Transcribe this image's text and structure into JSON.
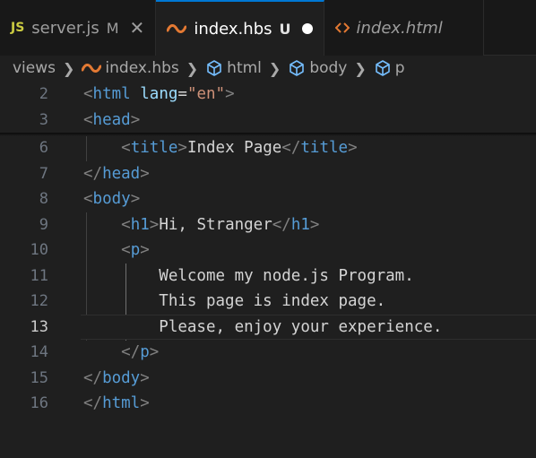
{
  "tabs": [
    {
      "icon": "js-file-icon",
      "icon_text": "JS",
      "label": "server.js",
      "status": "M",
      "active": false
    },
    {
      "icon": "handlebars-file-icon",
      "label": "index.hbs",
      "status": "U",
      "active": true
    },
    {
      "icon": "html-file-icon",
      "label": "index.html",
      "active": false
    }
  ],
  "breadcrumb": {
    "items": [
      "views",
      "index.hbs",
      "html",
      "body",
      "p"
    ]
  },
  "editor": {
    "current_line": "13",
    "lines": [
      {
        "num": "2",
        "tokens": [
          [
            "punc",
            "<"
          ],
          [
            "tag",
            "html"
          ],
          [
            "txt",
            " "
          ],
          [
            "attr",
            "lang"
          ],
          [
            "txt",
            "="
          ],
          [
            "str",
            "\"en\""
          ],
          [
            "punc",
            ">"
          ]
        ]
      },
      {
        "num": "3",
        "tokens": [
          [
            "punc",
            "<"
          ],
          [
            "tag",
            "head"
          ],
          [
            "punc",
            ">"
          ]
        ]
      },
      {
        "num": "6",
        "tokens": [
          [
            "txt",
            "    "
          ],
          [
            "punc",
            "<"
          ],
          [
            "tag",
            "title"
          ],
          [
            "punc",
            ">"
          ],
          [
            "txt",
            "Index Page"
          ],
          [
            "punc",
            "</"
          ],
          [
            "tag",
            "title"
          ],
          [
            "punc",
            ">"
          ]
        ]
      },
      {
        "num": "7",
        "tokens": [
          [
            "punc",
            "</"
          ],
          [
            "tag",
            "head"
          ],
          [
            "punc",
            ">"
          ]
        ]
      },
      {
        "num": "8",
        "tokens": [
          [
            "punc",
            "<"
          ],
          [
            "tag",
            "body"
          ],
          [
            "punc",
            ">"
          ]
        ]
      },
      {
        "num": "9",
        "tokens": [
          [
            "txt",
            "    "
          ],
          [
            "punc",
            "<"
          ],
          [
            "tag",
            "h1"
          ],
          [
            "punc",
            ">"
          ],
          [
            "txt",
            "Hi, Stranger"
          ],
          [
            "punc",
            "</"
          ],
          [
            "tag",
            "h1"
          ],
          [
            "punc",
            ">"
          ]
        ]
      },
      {
        "num": "10",
        "tokens": [
          [
            "txt",
            "    "
          ],
          [
            "punc",
            "<"
          ],
          [
            "tag",
            "p"
          ],
          [
            "punc",
            ">"
          ]
        ]
      },
      {
        "num": "11",
        "tokens": [
          [
            "txt",
            "        Welcome my node.js Program."
          ]
        ]
      },
      {
        "num": "12",
        "tokens": [
          [
            "txt",
            "        This page is index page."
          ]
        ]
      },
      {
        "num": "13",
        "tokens": [
          [
            "txt",
            "        Please, enjoy your experience."
          ]
        ]
      },
      {
        "num": "14",
        "tokens": [
          [
            "txt",
            "    "
          ],
          [
            "punc",
            "</"
          ],
          [
            "tag",
            "p"
          ],
          [
            "punc",
            ">"
          ]
        ]
      },
      {
        "num": "15",
        "tokens": [
          [
            "punc",
            "</"
          ],
          [
            "tag",
            "body"
          ],
          [
            "punc",
            ">"
          ]
        ]
      },
      {
        "num": "16",
        "tokens": [
          [
            "punc",
            "</"
          ],
          [
            "tag",
            "html"
          ],
          [
            "punc",
            ">"
          ]
        ]
      }
    ]
  },
  "colors": {
    "background": "#1f1f1f",
    "tag": "#569cd6",
    "attribute": "#9cdcfe",
    "string": "#ce9178",
    "punctuation": "#808080",
    "text": "#d4d4d4",
    "active_tab_border": "#0078d4",
    "js_icon": "#cbcb41",
    "hbs_icon": "#e37933"
  }
}
